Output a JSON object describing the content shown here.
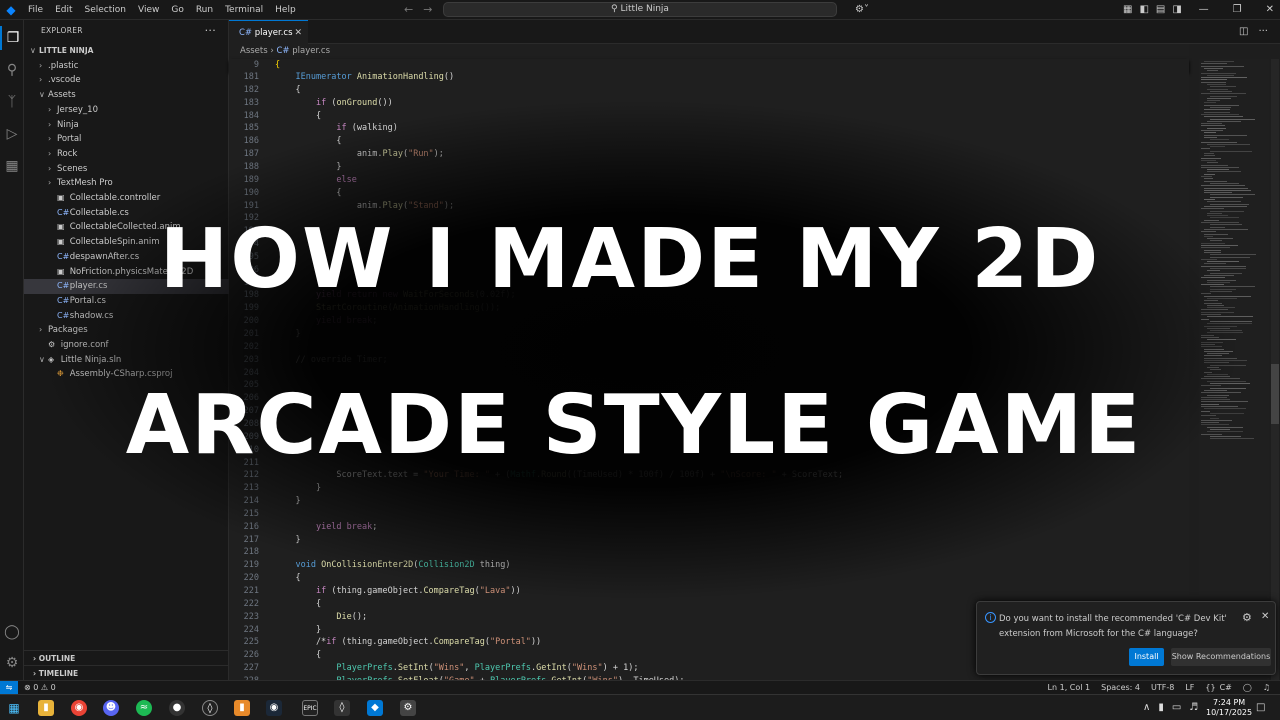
{
  "titlebar": {
    "menu": [
      "File",
      "Edit",
      "Selection",
      "View",
      "Go",
      "Run",
      "Terminal",
      "Help"
    ],
    "search": "Little Ninja"
  },
  "sidebar": {
    "title": "EXPLORER",
    "root": "LITTLE NINJA",
    "items": [
      {
        "label": ".plastic",
        "depth": 1,
        "type": "folder",
        "open": false
      },
      {
        "label": ".vscode",
        "depth": 1,
        "type": "folder",
        "open": false
      },
      {
        "label": "Assets",
        "depth": 1,
        "type": "folder",
        "open": true
      },
      {
        "label": "Jersey_10",
        "depth": 2,
        "type": "folder",
        "open": false
      },
      {
        "label": "Ninja",
        "depth": 2,
        "type": "folder",
        "open": false
      },
      {
        "label": "Portal",
        "depth": 2,
        "type": "folder",
        "open": false
      },
      {
        "label": "Rock",
        "depth": 2,
        "type": "folder",
        "open": false
      },
      {
        "label": "Scenes",
        "depth": 2,
        "type": "folder",
        "open": false
      },
      {
        "label": "TextMesh Pro",
        "depth": 2,
        "type": "folder",
        "open": false
      },
      {
        "label": "Collectable.controller",
        "depth": 2,
        "type": "unity"
      },
      {
        "label": "Collectable.cs",
        "depth": 2,
        "type": "cs"
      },
      {
        "label": "CollectableCollected.anim",
        "depth": 2,
        "type": "unity"
      },
      {
        "label": "CollectableSpin.anim",
        "depth": 2,
        "type": "unity"
      },
      {
        "label": "despawnAfter.cs",
        "depth": 2,
        "type": "cs"
      },
      {
        "label": "NoFriction.physicsMaterial2D",
        "depth": 2,
        "type": "unity"
      },
      {
        "label": "player.cs",
        "depth": 2,
        "type": "cs",
        "selected": true
      },
      {
        "label": "Portal.cs",
        "depth": 2,
        "type": "cs"
      },
      {
        "label": "shadow.cs",
        "depth": 2,
        "type": "cs"
      },
      {
        "label": "Packages",
        "depth": 1,
        "type": "folder",
        "open": false
      },
      {
        "label": "ignore.conf",
        "depth": 1,
        "type": "gear"
      },
      {
        "label": "Little Ninja.sln",
        "depth": 1,
        "type": "sln",
        "open": true
      },
      {
        "label": "Assembly-CSharp.csproj",
        "depth": 2,
        "type": "proj"
      }
    ],
    "outline": "OUTLINE",
    "timeline": "TIMELINE"
  },
  "editor": {
    "tab": "player.cs",
    "breadcrumb": [
      "Assets",
      "player.cs"
    ],
    "sticky": {
      "num": "9",
      "text": "{"
    },
    "lines": [
      {
        "n": "181",
        "t": "    IEnumerator AnimationHandling()"
      },
      {
        "n": "182",
        "t": "    {"
      },
      {
        "n": "183",
        "t": "        if (onGround())"
      },
      {
        "n": "184",
        "t": "        {"
      },
      {
        "n": "185",
        "t": "            if (walking)"
      },
      {
        "n": "186",
        "t": "            {"
      },
      {
        "n": "187",
        "t": "                anim.Play(\"Run\");"
      },
      {
        "n": "188",
        "t": "            }"
      },
      {
        "n": "189",
        "t": "            else"
      },
      {
        "n": "190",
        "t": "            {"
      },
      {
        "n": "191",
        "t": "                anim.Play(\"Stand\");"
      },
      {
        "n": "192",
        "t": ""
      },
      {
        "n": "193",
        "t": ""
      },
      {
        "n": "194",
        "t": ""
      },
      {
        "n": "195",
        "t": ""
      },
      {
        "n": "196",
        "t": ""
      },
      {
        "n": "197",
        "t": ""
      },
      {
        "n": "198",
        "t": "        yield return new WaitForSeconds(0.02f);"
      },
      {
        "n": "199",
        "t": "        StartCoroutine(AnimationHandling());"
      },
      {
        "n": "200",
        "t": "        yield break;"
      },
      {
        "n": "201",
        "t": "    }"
      },
      {
        "n": "202",
        "t": ""
      },
      {
        "n": "203",
        "t": "    // override Timer;"
      },
      {
        "n": "204",
        "t": ""
      },
      {
        "n": "205",
        "t": ""
      },
      {
        "n": "206",
        "t": ""
      },
      {
        "n": "207",
        "t": ""
      },
      {
        "n": "208",
        "t": ""
      },
      {
        "n": "209",
        "t": ""
      },
      {
        "n": "210",
        "t": ""
      },
      {
        "n": "211",
        "t": ""
      },
      {
        "n": "212",
        "t": "            ScoreText.text = \"Your Time: \" + (Mathf.Round((TimeUsed) * 100f) / 100f) + \"\\nScore: \" + ScoreText;"
      },
      {
        "n": "213",
        "t": "        }"
      },
      {
        "n": "214",
        "t": "    }"
      },
      {
        "n": "215",
        "t": ""
      },
      {
        "n": "216",
        "t": "        yield break;"
      },
      {
        "n": "217",
        "t": "    }"
      },
      {
        "n": "218",
        "t": ""
      },
      {
        "n": "219",
        "t": "    void OnCollisionEnter2D(Collision2D thing)"
      },
      {
        "n": "220",
        "t": "    {"
      },
      {
        "n": "221",
        "t": "        if (thing.gameObject.CompareTag(\"Lava\"))"
      },
      {
        "n": "222",
        "t": "        {"
      },
      {
        "n": "223",
        "t": "            Die();"
      },
      {
        "n": "224",
        "t": "        }"
      },
      {
        "n": "225",
        "t": "        /*if (thing.gameObject.CompareTag(\"Portal\"))"
      },
      {
        "n": "226",
        "t": "        {"
      },
      {
        "n": "227",
        "t": "            PlayerPrefs.SetInt(\"Wins\", PlayerPrefs.GetInt(\"Wins\") + 1);"
      },
      {
        "n": "228",
        "t": "            PlayerPrefs.SetFloat(\"Game\" + PlayerPrefs.GetInt(\"Wins\"), TimeUsed);"
      }
    ]
  },
  "headline": {
    "line1": "HOW I MADE MY 2D",
    "line2": "ARCADE STYLE GAME"
  },
  "notification": {
    "message": "Do you want to install the recommended 'C# Dev Kit' extension from Microsoft for the C# language?",
    "install": "Install",
    "show_recommendations": "Show Recommendations"
  },
  "status": {
    "errors": "⊗ 0 ⚠ 0",
    "position": "Ln 1, Col 1",
    "spaces": "Spaces: 4",
    "encoding": "UTF-8",
    "eol": "LF",
    "language": "C#"
  },
  "taskbar": {
    "time": "7:24 PM",
    "date": "10/17/2025"
  }
}
